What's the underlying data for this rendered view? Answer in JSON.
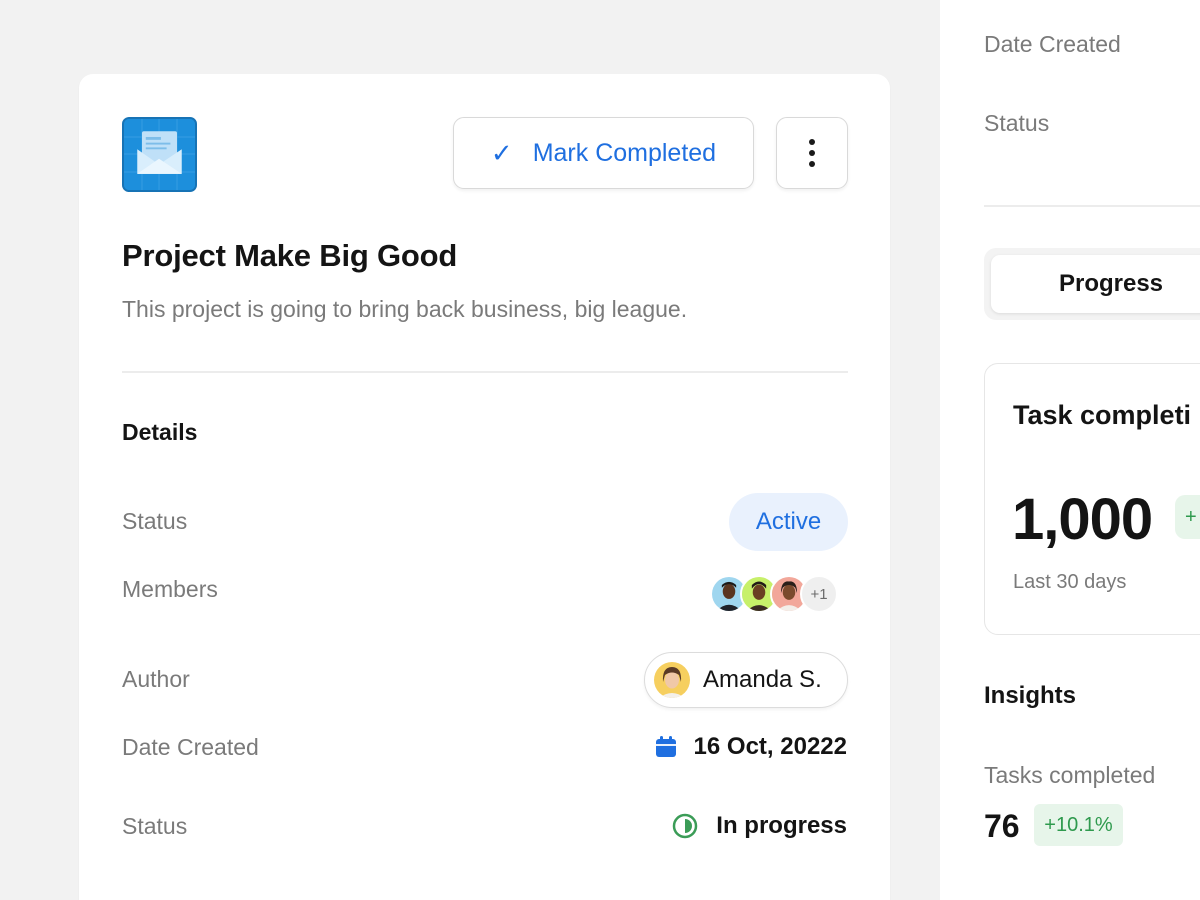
{
  "project": {
    "title": "Project Make Big Good",
    "description": "This project is going to bring back business, big league.",
    "mark_completed_label": "Mark Completed",
    "check_glyph": "✓"
  },
  "details": {
    "title": "Details",
    "status_label": "Status",
    "status_value": "Active",
    "members_label": "Members",
    "members_extra": "+1",
    "author_label": "Author",
    "author_name": "Amanda S.",
    "date_label": "Date Created",
    "date_value": "16 Oct, 20222",
    "progress_label": "Status",
    "progress_value": "In progress"
  },
  "side_panel": {
    "date_label": "Date Created",
    "status_label": "Status",
    "tab_active": "Progress",
    "task_card": {
      "title": "Task completi",
      "value": "1,000",
      "delta": "+",
      "period": "Last 30 days"
    },
    "insights_title": "Insights",
    "tasks_completed_label": "Tasks completed",
    "tasks_completed_value": "76",
    "tasks_completed_delta": "+10.1%"
  },
  "colors": {
    "accent": "#1f6fe0",
    "active_badge_bg": "#e9f1fd",
    "success": "#2f9a4e",
    "success_bg": "#e7f5ea",
    "app_icon": "#1d8fdc"
  },
  "icons": {
    "app": "envelope-icon",
    "check": "check-icon",
    "more": "more-vertical-icon",
    "date": "calendar-icon",
    "progress": "half-circle-icon"
  }
}
